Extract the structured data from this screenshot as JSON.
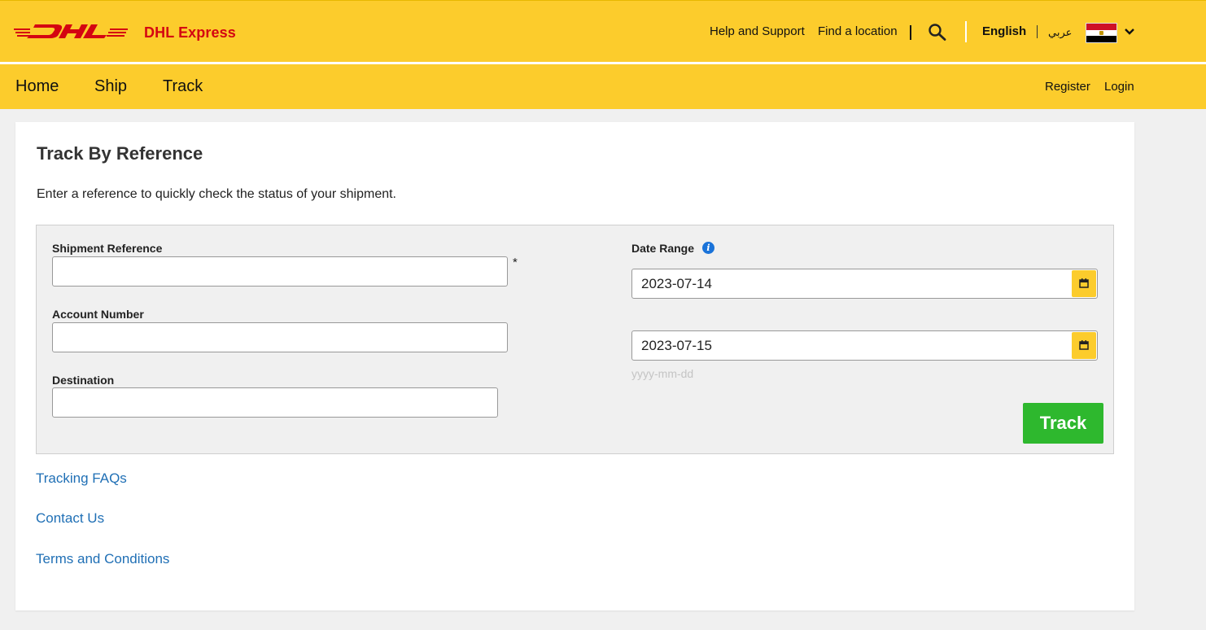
{
  "brand": {
    "logo_text": "DHL",
    "name": "DHL Express",
    "logo_color": "#d40511",
    "header_color": "#fccc2c"
  },
  "header": {
    "help_link": "Help and Support",
    "location_link": "Find a location",
    "search_icon": "search-icon",
    "language_current": "English",
    "language_alt": "عربي",
    "country_flag": "egypt-flag-icon"
  },
  "nav": {
    "items": [
      {
        "label": "Home"
      },
      {
        "label": "Ship"
      },
      {
        "label": "Track"
      }
    ],
    "register": "Register",
    "login": "Login"
  },
  "main": {
    "title": "Track By Reference",
    "intro": "Enter a reference to quickly check the status of your shipment.",
    "form": {
      "shipment_reference_label": "Shipment Reference",
      "shipment_reference_value": "",
      "required_mark": "*",
      "account_number_label": "Account Number",
      "account_number_value": "",
      "destination_label": "Destination",
      "destination_value": "",
      "date_range_label": "Date Range",
      "info_icon_glyph": "i",
      "date_from": "2023-07-14",
      "date_to": "2023-07-15",
      "date_format_hint": "yyyy-mm-dd",
      "track_button": "Track",
      "track_button_color": "#2eb82e"
    },
    "links": {
      "faqs": "Tracking FAQs",
      "contact": "Contact Us",
      "terms": "Terms and Conditions"
    },
    "link_color": "#1f6fb5"
  }
}
